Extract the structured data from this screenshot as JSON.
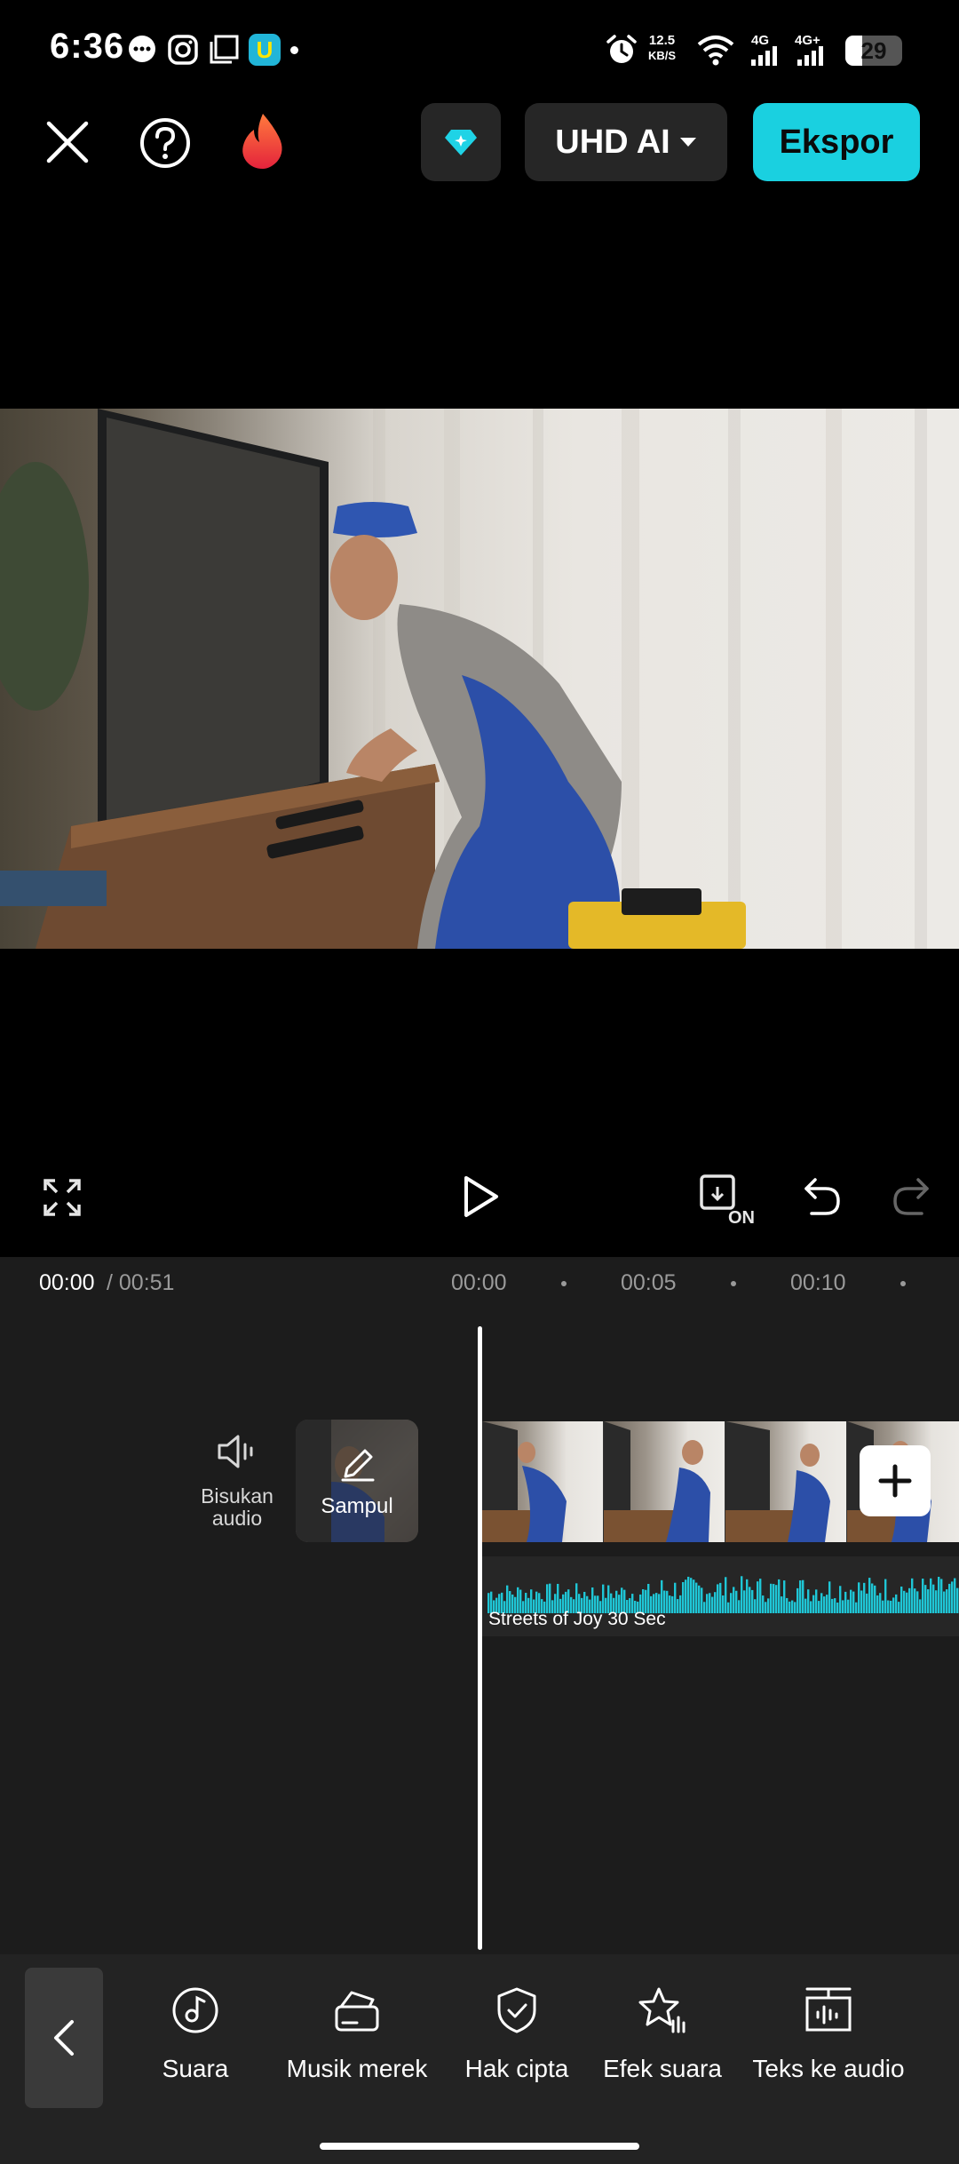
{
  "status_bar": {
    "time": "6:36",
    "net_speed_value": "12.5",
    "net_speed_unit": "KB/S",
    "net_type_1": "4G",
    "net_type_2": "4G+",
    "battery": "29",
    "battery_level_percent": 29
  },
  "toolbar": {
    "quality_label": "UHD AI",
    "export_label": "Ekspor"
  },
  "playback": {
    "current_time": "00:00",
    "total_time": "/ 00:51",
    "ruler": [
      "00:00",
      "00:05",
      "00:10"
    ]
  },
  "timeline": {
    "mute_label": "Bisukan audio",
    "cover_label": "Sampul",
    "audio_track_name": "Streets of Joy 30 Sec"
  },
  "bottom_tools": [
    {
      "label": "Suara",
      "icon": "music-note-icon"
    },
    {
      "label": "Musik merek",
      "icon": "brand-music-icon"
    },
    {
      "label": "Hak cipta",
      "icon": "shield-check-icon"
    },
    {
      "label": "Efek suara",
      "icon": "sound-effect-star-icon"
    },
    {
      "label": "Teks ke audio",
      "icon": "text-to-audio-icon"
    }
  ],
  "colors": {
    "accent": "#1ad0e0",
    "waveform": "#1fc6d6",
    "background": "#000000",
    "panel": "#1c1c1c"
  }
}
